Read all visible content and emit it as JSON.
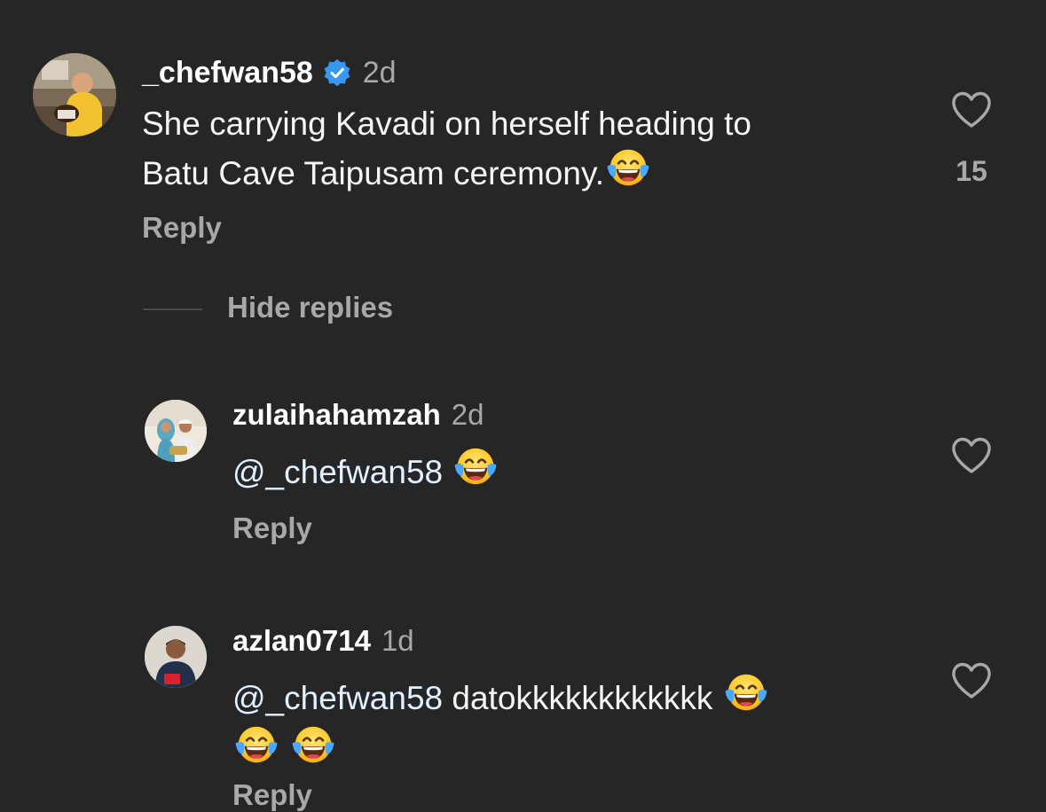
{
  "comments": [
    {
      "username": "_chefwan58",
      "verified": true,
      "time": "2d",
      "text_line1": "She carrying Kavadi on herself heading to",
      "text_line2": "Batu Cave Taipusam ceremony.",
      "likes": "15",
      "reply_label": "Reply",
      "emoji": "face-with-tears-of-joy"
    }
  ],
  "hide_replies_label": "Hide replies",
  "replies": [
    {
      "username": "zulaihahamzah",
      "time": "2d",
      "mention": "@_chefwan58",
      "text": "",
      "reply_label": "Reply",
      "emoji": "face-with-tears-of-joy"
    },
    {
      "username": "azlan0714",
      "time": "1d",
      "mention": "@_chefwan58",
      "text": "datokkkkkkkkkkkk",
      "reply_label": "Reply",
      "emoji": "face-with-tears-of-joy"
    }
  ],
  "colors": {
    "background": "#262626",
    "text": "#f5f5f5",
    "secondary": "#a8a8a8",
    "verified_badge": "#3897f0",
    "mention": "#e0f1ff"
  }
}
